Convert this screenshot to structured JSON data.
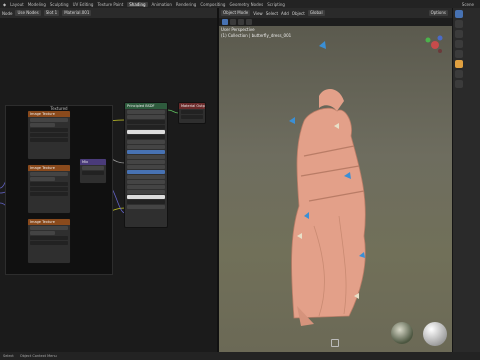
{
  "menu_bar": {
    "tabs": [
      "Layout",
      "Modeling",
      "Sculpting",
      "UV Editing",
      "Texture Paint",
      "Shading",
      "Animation",
      "Rendering",
      "Compositing",
      "Geometry Nodes",
      "Scripting"
    ],
    "active_tab": "Shading",
    "scene_label": "Scene"
  },
  "node_header": {
    "editor_mode": "Node",
    "use_nodes": "Use Nodes",
    "slot": "Slot 1",
    "material": "Material.001"
  },
  "node_editor": {
    "frame_label": "Textured",
    "nodes": [
      {
        "title": "Principled BSDF"
      },
      {
        "title": "Material Output"
      },
      {
        "title": "Image Texture"
      },
      {
        "title": "Image Texture"
      },
      {
        "title": "Image Texture"
      },
      {
        "title": "Mix"
      }
    ]
  },
  "viewport_header": {
    "mode": "Object Mode",
    "menus": [
      "View",
      "Select",
      "Add",
      "Object"
    ],
    "orientation": "Global",
    "options": "Options"
  },
  "viewport": {
    "perspective": "User Perspective",
    "collection": "(1) Collection | butterfly_dress_001"
  },
  "status_bar": {
    "left": "Select",
    "middle": "Object Context Menu"
  },
  "colors": {
    "accent": "#4772b3",
    "dress": "#e3a089",
    "node_header_orange": "#8a4a1c",
    "node_header_green": "#2e5b3d",
    "node_header_red": "#6a2a2a",
    "node_header_purple": "#4a3b7a",
    "butterfly_blue": "#3a8fd6"
  }
}
